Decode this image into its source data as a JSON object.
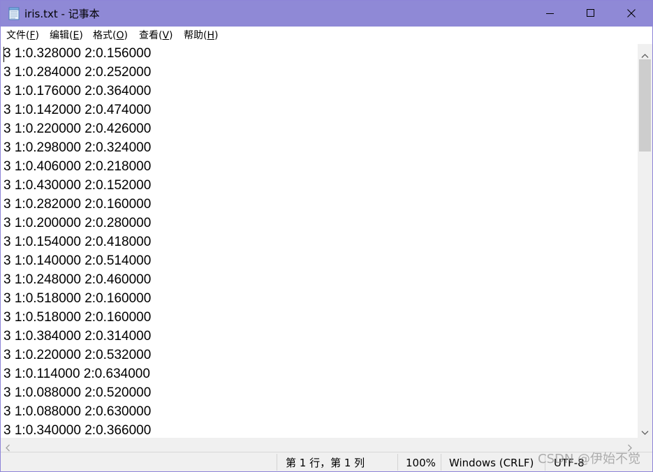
{
  "window": {
    "title": "iris.txt - 记事本"
  },
  "menu": [
    {
      "label": "文件(",
      "key": "F",
      "end": ")"
    },
    {
      "label": "编辑(",
      "key": "E",
      "end": ")"
    },
    {
      "label": "格式(",
      "key": "O",
      "end": ")"
    },
    {
      "label": "查看(",
      "key": "V",
      "end": ")"
    },
    {
      "label": "帮助(",
      "key": "H",
      "end": ")"
    }
  ],
  "editor": {
    "lines": [
      "3 1:0.328000 2:0.156000",
      "3 1:0.284000 2:0.252000",
      "3 1:0.176000 2:0.364000",
      "3 1:0.142000 2:0.474000",
      "3 1:0.220000 2:0.426000",
      "3 1:0.298000 2:0.324000",
      "3 1:0.406000 2:0.218000",
      "3 1:0.430000 2:0.152000",
      "3 1:0.282000 2:0.160000",
      "3 1:0.200000 2:0.280000",
      "3 1:0.154000 2:0.418000",
      "3 1:0.140000 2:0.514000",
      "3 1:0.248000 2:0.460000",
      "3 1:0.518000 2:0.160000",
      "3 1:0.518000 2:0.160000",
      "3 1:0.384000 2:0.314000",
      "3 1:0.220000 2:0.532000",
      "3 1:0.114000 2:0.634000",
      "3 1:0.088000 2:0.520000",
      "3 1:0.088000 2:0.630000",
      "3 1:0.340000 2:0.366000"
    ]
  },
  "status": {
    "position": "第 1 行，第 1 列",
    "zoom": "100%",
    "line_ending": "Windows (CRLF)",
    "encoding": "UTF-8"
  },
  "watermark": "CSDN @伊始不觉",
  "icons": {
    "app": "notepad-icon",
    "minimize": "minimize-icon",
    "maximize": "maximize-icon",
    "close": "close-icon"
  },
  "colors": {
    "titlebar": "#8f89d6",
    "border": "#8d84d8",
    "statusbar": "#f0f0f0"
  }
}
